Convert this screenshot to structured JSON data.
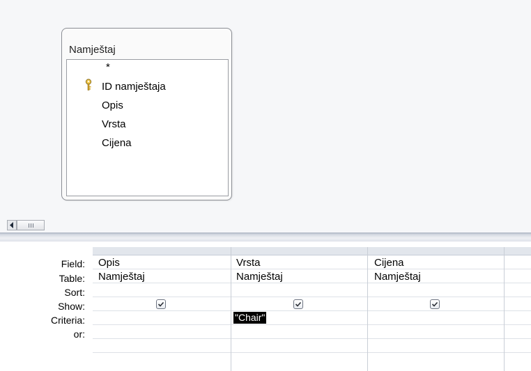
{
  "table": {
    "title": "Namještaj",
    "fields": [
      "*",
      "ID namještaja",
      "Opis",
      "Vrsta",
      "Cijena"
    ],
    "primary_key_field": "ID namještaja"
  },
  "grid": {
    "row_labels": {
      "field": "Field:",
      "table": "Table:",
      "sort": "Sort:",
      "show": "Show:",
      "criteria": "Criteria:",
      "or": "or:"
    },
    "columns": [
      {
        "field": "Opis",
        "table": "Namještaj",
        "sort": "",
        "show": true,
        "criteria": ""
      },
      {
        "field": "Vrsta",
        "table": "Namještaj",
        "sort": "",
        "show": true,
        "criteria": "\"Chair\""
      },
      {
        "field": "Cijena",
        "table": "Namještaj",
        "sort": "",
        "show": true,
        "criteria": ""
      }
    ]
  },
  "colors": {
    "selection_bg": "#000000",
    "selection_fg": "#ffffff",
    "design_bg": "#f6f7f9"
  }
}
